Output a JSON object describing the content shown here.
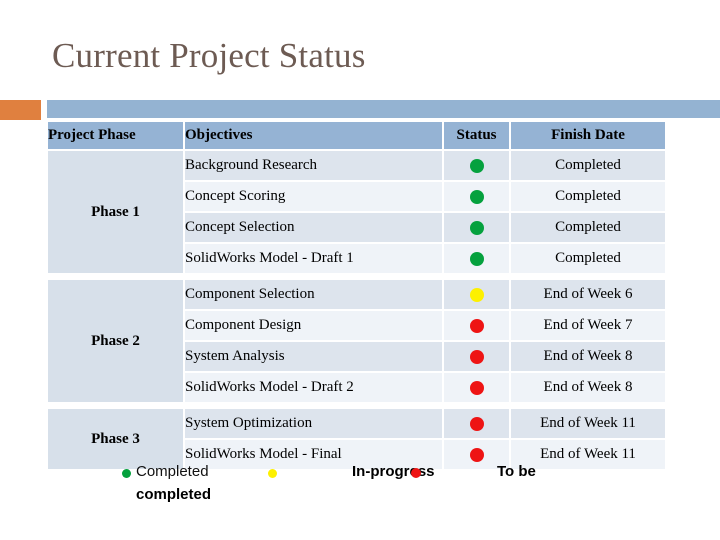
{
  "slide": {
    "title": "Current Project Status"
  },
  "theme": {
    "accent_orange": "#e0803f",
    "accent_blue": "#94b3d2",
    "header_blue": "#95b3d4",
    "phase_cell_blue": "#d7e0ea",
    "row_tint_a": "#dde4ed",
    "row_tint_b": "#eff3f8",
    "title_color": "#6d5b53",
    "status_green": "#05a13e",
    "status_yellow": "#fdf000",
    "status_red": "#ee1414"
  },
  "table": {
    "headers": {
      "phase": "Project Phase",
      "objectives": "Objectives",
      "status": "Status",
      "finish_date": "Finish Date"
    },
    "phases": [
      {
        "name": "Phase 1",
        "rows": [
          {
            "objective": "Background Research",
            "status": "green",
            "finish_date": "Completed"
          },
          {
            "objective": "Concept Scoring",
            "status": "green",
            "finish_date": "Completed"
          },
          {
            "objective": "Concept Selection",
            "status": "green",
            "finish_date": "Completed"
          },
          {
            "objective": "SolidWorks Model - Draft 1",
            "status": "green",
            "finish_date": "Completed"
          }
        ]
      },
      {
        "name": "Phase 2",
        "rows": [
          {
            "objective": "Component Selection",
            "status": "yellow",
            "finish_date": "End of Week 6"
          },
          {
            "objective": "Component Design",
            "status": "red",
            "finish_date": "End of Week 7"
          },
          {
            "objective": "System Analysis",
            "status": "red",
            "finish_date": "End of Week 8"
          },
          {
            "objective": "SolidWorks Model - Draft 2",
            "status": "red",
            "finish_date": "End of Week 8"
          }
        ]
      },
      {
        "name": "Phase 3",
        "rows": [
          {
            "objective": "System Optimization",
            "status": "red",
            "finish_date": "End of Week 11"
          },
          {
            "objective": "SolidWorks Model - Final",
            "status": "red",
            "finish_date": "End of Week 11"
          }
        ]
      }
    ]
  },
  "legend": {
    "completed_label": "Completed",
    "completed_wrap_label": "completed",
    "inprogress_label": "In-progress",
    "tobe_label": "To be"
  }
}
